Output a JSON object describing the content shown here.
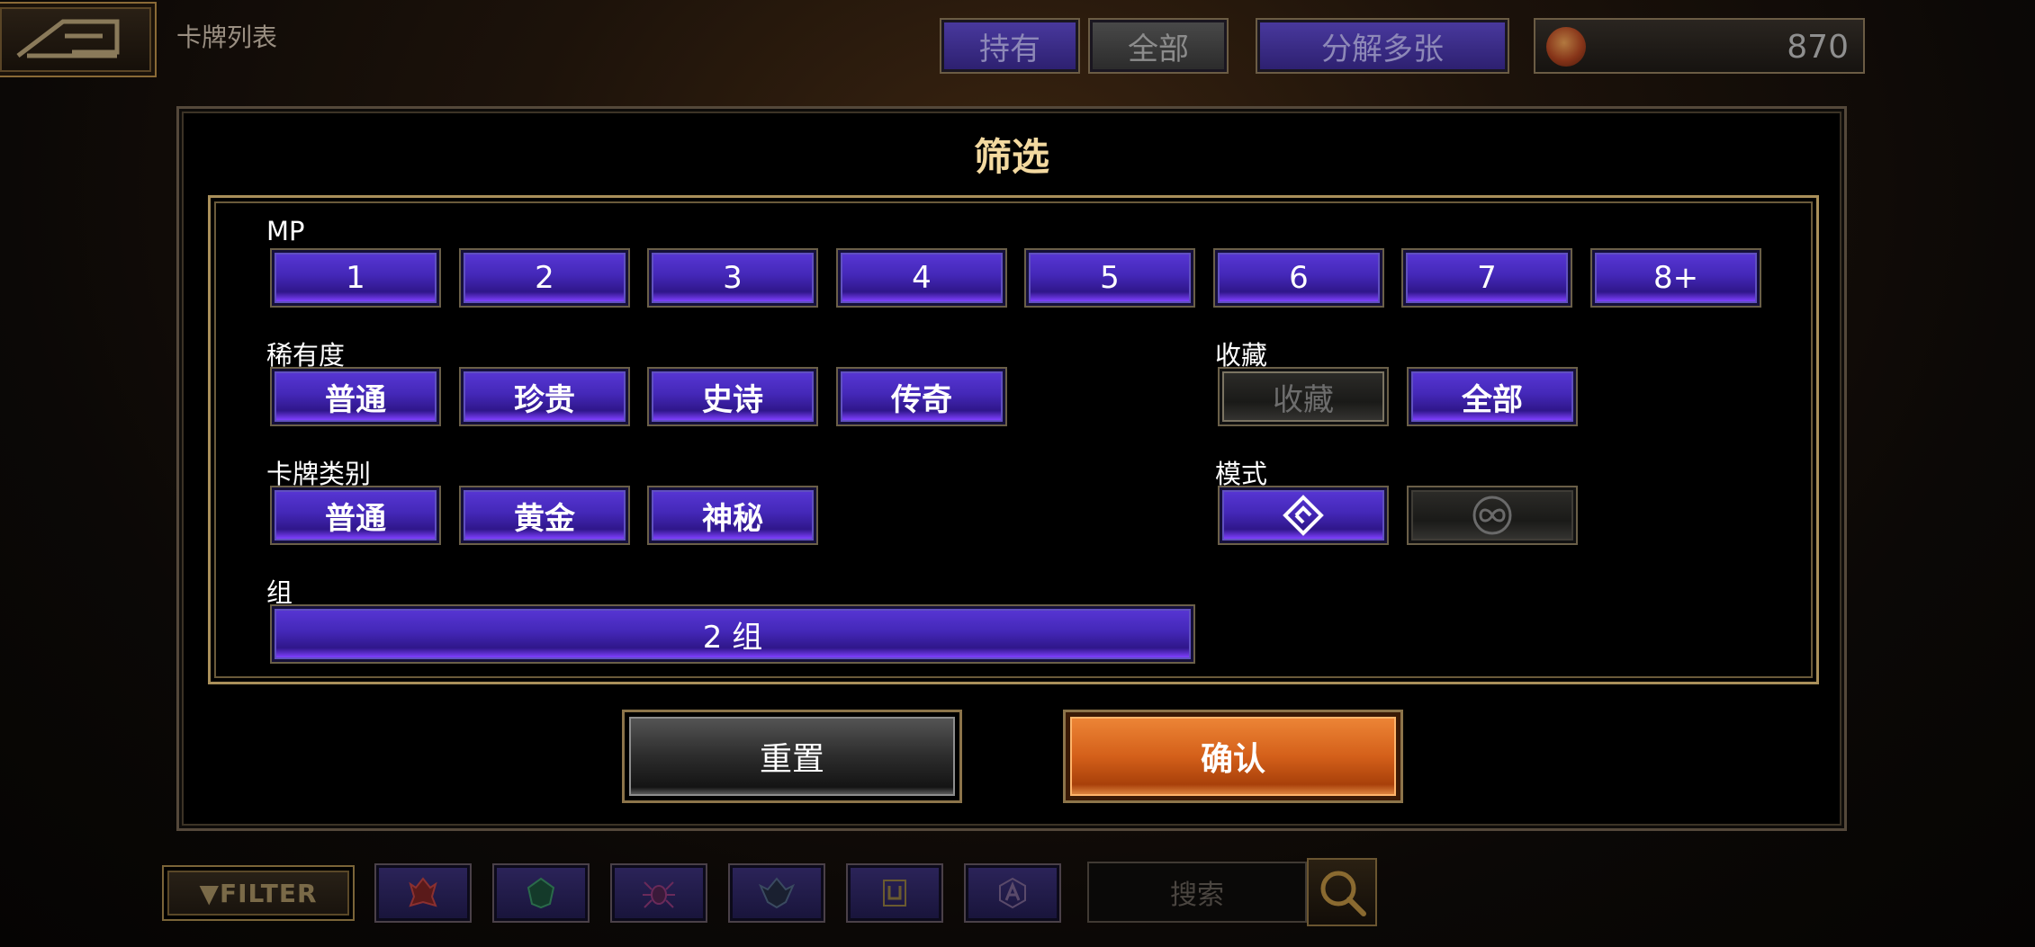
{
  "header": {
    "page_title": "卡牌列表",
    "tabs": [
      {
        "label": "持有",
        "state": "selected"
      },
      {
        "label": "全部",
        "state": "unselected"
      }
    ],
    "decompose_label": "分解多张",
    "currency": {
      "icon": "flame-coin-icon",
      "amount": "870"
    }
  },
  "dialog": {
    "title": "筛选",
    "mp": {
      "label": "MP",
      "options": [
        "1",
        "2",
        "3",
        "4",
        "5",
        "6",
        "7",
        "8+"
      ]
    },
    "rarity": {
      "label": "稀有度",
      "options": [
        "普通",
        "珍贵",
        "史诗",
        "传奇"
      ]
    },
    "favorites": {
      "label": "收藏",
      "options": [
        {
          "label": "收藏",
          "state": "off"
        },
        {
          "label": "全部",
          "state": "on"
        }
      ]
    },
    "card_type": {
      "label": "卡牌类别",
      "options": [
        "普通",
        "黄金",
        "神秘"
      ]
    },
    "mode": {
      "label": "模式",
      "options": [
        {
          "icon": "diamond-mode-icon",
          "state": "on"
        },
        {
          "icon": "infinity-mode-icon",
          "state": "off"
        }
      ]
    },
    "group": {
      "label": "组",
      "value": "2 组"
    },
    "reset_label": "重置",
    "confirm_label": "确认"
  },
  "bottom_bar": {
    "filter_label": "▼FILTER",
    "faction_icons": [
      "red-faction-icon",
      "green-faction-icon",
      "spider-faction-icon",
      "dark-faction-icon",
      "u-faction-icon",
      "a-faction-icon"
    ],
    "search_placeholder": "搜索",
    "search_icon": "search-icon"
  },
  "colors": {
    "purple_button": "#4428b8",
    "confirm_orange": "#d4601a",
    "dialog_title": "#f3d9a0",
    "panel_border": "#a98f5a"
  }
}
